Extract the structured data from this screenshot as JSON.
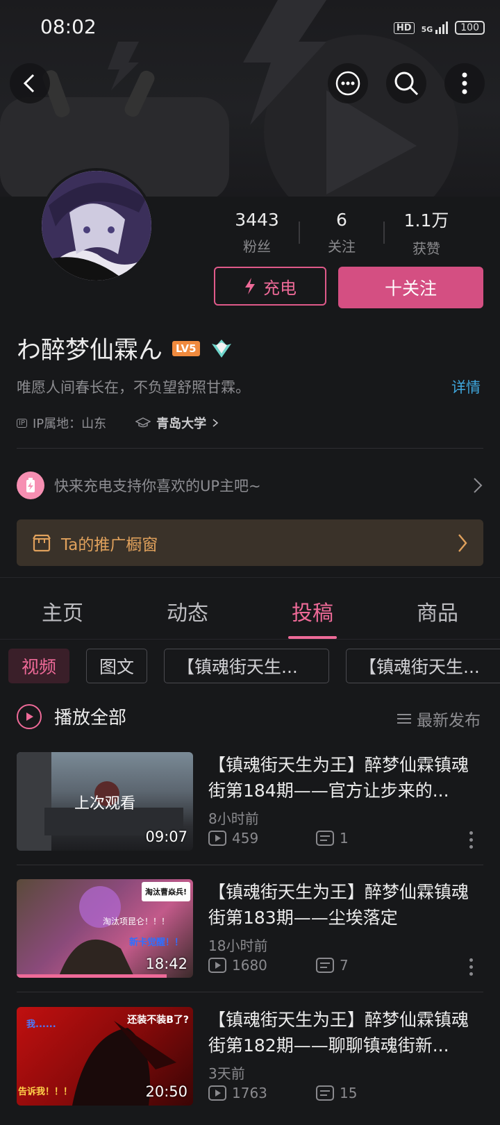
{
  "status_bar": {
    "time": "08:02",
    "hd": "HD",
    "network": "5G",
    "battery": "100"
  },
  "profile": {
    "stats": [
      {
        "value": "3443",
        "label": "粉丝"
      },
      {
        "value": "6",
        "label": "关注"
      },
      {
        "value": "1.1万",
        "label": "获赞"
      }
    ],
    "charge_label": "充电",
    "follow_label": "十关注",
    "name": "わ醉梦仙霖ん",
    "level": "LV5",
    "bio": "唯愿人间春长在，不负望舒照甘霖。",
    "detail_link": "详情",
    "ip_badge": "IP",
    "ip_location": "IP属地：山东",
    "school": "青岛大学"
  },
  "charge_tip": "快来充电支持你喜欢的UP主吧~",
  "shop_window": "Ta的推广橱窗",
  "tabs": [
    {
      "label": "主页",
      "active": false
    },
    {
      "label": "动态",
      "active": false
    },
    {
      "label": "投稿",
      "active": true
    },
    {
      "label": "商品",
      "active": false
    }
  ],
  "chips": [
    "视频",
    "图文",
    "【镇魂街天生...",
    "【镇魂街天生..."
  ],
  "play_all": "播放全部",
  "sort": "最新发布",
  "videos": [
    {
      "title": "【镇魂街天生为王】醉梦仙霖镇魂街第184期——官方让步来的...",
      "time": "8小时前",
      "views": "459",
      "comments": "1",
      "duration": "09:07",
      "overlay": "上次观看"
    },
    {
      "title": "【镇魂街天生为王】醉梦仙霖镇魂街第183期——尘埃落定",
      "time": "18小时前",
      "views": "1680",
      "comments": "7",
      "duration": "18:42",
      "thumb_texts": [
        "淘汰曹焱兵!",
        "淘汰项昆仑！！！",
        "新卡觉醒！！"
      ]
    },
    {
      "title": "【镇魂街天生为王】醉梦仙霖镇魂街第182期——聊聊镇魂街新...",
      "time": "3天前",
      "views": "1763",
      "comments": "15",
      "duration": "20:50",
      "thumb_texts": [
        "我......",
        "还装不装B了?",
        "告诉我！！！"
      ]
    }
  ],
  "colors": {
    "accent": "#ee6a98",
    "follow_bg": "#d44f82",
    "link": "#3fa7dd",
    "shop_text": "#e0a15c"
  }
}
